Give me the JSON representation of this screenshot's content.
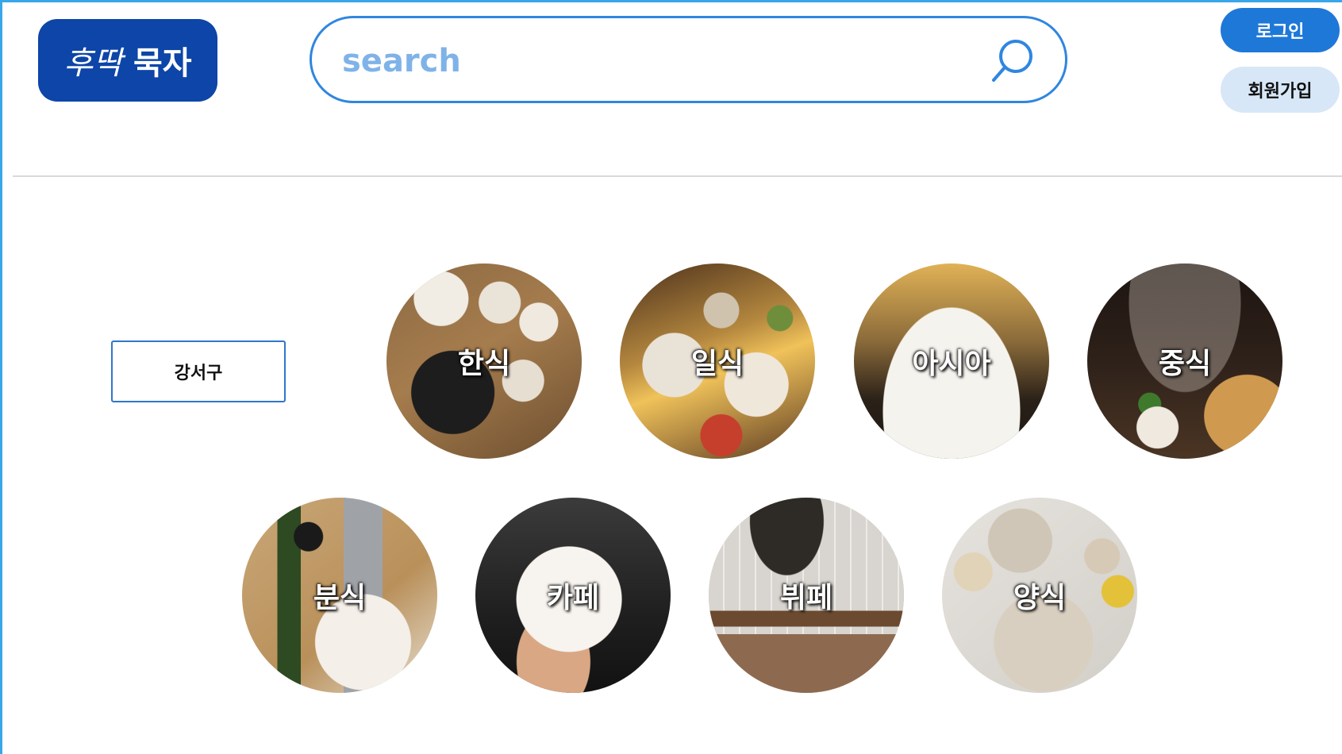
{
  "header": {
    "logo": {
      "text_italic": "후딱",
      "text_bold": "묵자"
    },
    "search": {
      "placeholder": "search",
      "value": ""
    },
    "auth": {
      "login_label": "로그인",
      "signup_label": "회원가입"
    }
  },
  "filter": {
    "region_label": "강서구"
  },
  "categories": [
    {
      "label": "한식",
      "icon": "korean-food-photo"
    },
    {
      "label": "일식",
      "icon": "japanese-food-photo"
    },
    {
      "label": "아시아",
      "icon": "asian-food-photo"
    },
    {
      "label": "중식",
      "icon": "chinese-food-photo"
    },
    {
      "label": "분식",
      "icon": "snack-food-photo"
    },
    {
      "label": "카페",
      "icon": "cafe-photo"
    },
    {
      "label": "뷔페",
      "icon": "buffet-photo"
    },
    {
      "label": "양식",
      "icon": "western-food-photo"
    }
  ],
  "colors": {
    "brand": "#0d45a8",
    "accent": "#2f86e0",
    "login_bg": "#1e78d8",
    "signup_bg": "#d7e7f7"
  }
}
